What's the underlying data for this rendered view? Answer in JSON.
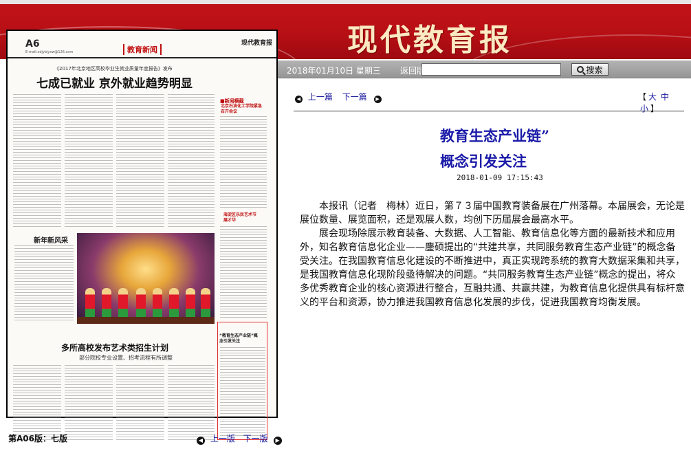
{
  "banner": {
    "title": "现代教育报"
  },
  "newspaper_page": {
    "page_no": "A6",
    "email": "E-mail:xdjybjyxw@126.com",
    "section": "教育新闻",
    "logo": "现代教育报",
    "report_subtitle": "《2017年北京地区高校毕业生就业质量年度报告》发布",
    "main_headline": "七成已就业  京外就业趋势明显",
    "sidebar_head": "■新闻横截",
    "sidebar_title": "北京石油化工学院紧急召开会议",
    "sidebar_title2": "海淀区乐民艺术节展才华",
    "feature_label": "新年新风采",
    "headline2": "多所高校发布艺术类招生计划",
    "subtitle2": "部分院校专业设置、招考流程有所调整",
    "highlight_title": "“教育生态产业链”概念引发关注"
  },
  "page_nav": {
    "edition": "第A06版：七版",
    "prev": "上一版",
    "next": "下一版"
  },
  "toolbar": {
    "date": "2018年01月10日 星期三",
    "back": "返回版首",
    "search_value": "",
    "search_label": "搜索"
  },
  "article_nav": {
    "prev": "上一篇",
    "next": "下一篇",
    "font_open": "【",
    "font_large": "大",
    "font_medium": "中",
    "font_small": "小",
    "font_close": "】"
  },
  "article": {
    "title_line1": "教育生态产业链”",
    "title_line2": "概念引发关注",
    "timestamp": "2018-01-09 17:15:43",
    "paragraphs": [
      "本报讯（记者　梅林）近日，第７３届中国教育装备展在广州落幕。本届展会，无论是展位数量、展览面积，还是观展人数，均创下历届展会最高水平。",
      "展会现场除展示教育装备、大数据、人工智能、教育信息化等方面的最新技术和应用外，知名教育信息化企业——鏖硕提出的“共建共享，共同服务教育生态产业链”的概念备受关注。在我国教育信息化建设的不断推进中，真正实现跨系统的教育大数据采集和共享，是我国教育信息化现阶段亟待解决的问题。“共同服务教育生态产业链”概念的提出，将众多优秀教育企业的核心资源进行整合，互融共通、共赢共建，为教育信息化提供具有标杆意义的平台和资源，协力推进我国教育信息化发展的步伐，促进我国教育均衡发展。"
    ]
  },
  "colors": {
    "banner_red": "#b80f15",
    "banner_text": "#fbe9c2",
    "link_blue": "#1a1aa0",
    "title_blue": "#1a1aa8",
    "highlight_red": "#e23030"
  }
}
